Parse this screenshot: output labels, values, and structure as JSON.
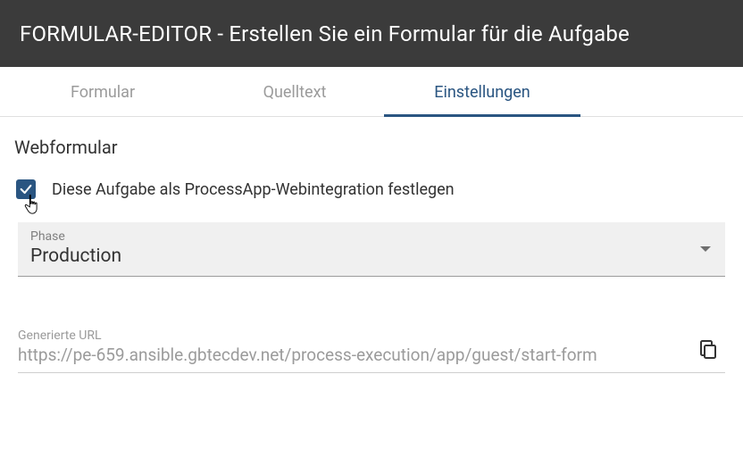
{
  "header": {
    "title": "FORMULAR-EDITOR - Erstellen Sie ein Formular für die Aufgabe"
  },
  "tabs": {
    "form": "Formular",
    "source": "Quelltext",
    "settings": "Einstellungen",
    "active": "settings"
  },
  "section": {
    "title": "Webformular"
  },
  "checkbox": {
    "checked": true,
    "label": "Diese Aufgabe als ProcessApp-Webintegration festlegen"
  },
  "phase": {
    "label": "Phase",
    "value": "Production"
  },
  "url": {
    "label": "Generierte URL",
    "value": "https://pe-659.ansible.gbtecdev.net/process-execution/app/guest/start-form"
  }
}
